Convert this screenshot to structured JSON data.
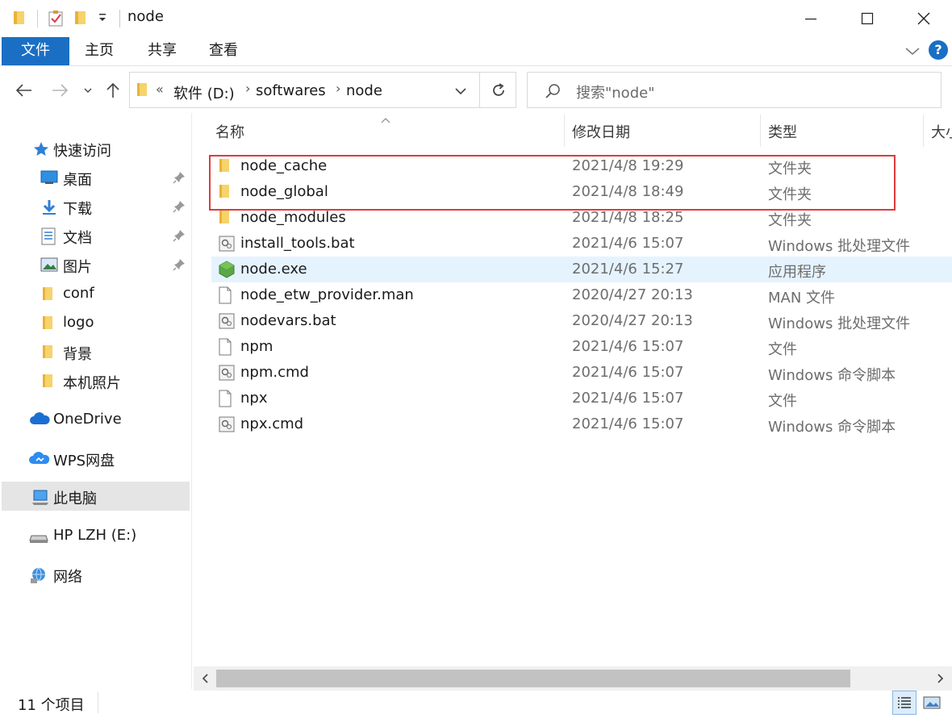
{
  "window": {
    "title": "node",
    "minimize_icon": "minimize-icon",
    "maximize_icon": "maximize-icon",
    "close_icon": "close-icon"
  },
  "ribbon": {
    "tabs": [
      {
        "label": "文件"
      },
      {
        "label": "主页"
      },
      {
        "label": "共享"
      },
      {
        "label": "查看"
      }
    ],
    "accent": "#1a6fc4",
    "help_label": "?"
  },
  "address": {
    "overflow": "«",
    "crumbs": [
      "软件 (D:)",
      "softwares",
      "node"
    ],
    "separator": "›"
  },
  "search": {
    "placeholder": "搜索\"node\""
  },
  "sidebar": {
    "quick_access": "快速访问",
    "pinned": [
      {
        "label": "桌面",
        "icon": "desktop-icon"
      },
      {
        "label": "下载",
        "icon": "download-icon"
      },
      {
        "label": "文档",
        "icon": "document-icon"
      },
      {
        "label": "图片",
        "icon": "pictures-icon"
      }
    ],
    "folders": [
      {
        "label": "conf"
      },
      {
        "label": "logo"
      },
      {
        "label": "背景"
      },
      {
        "label": "本机照片"
      }
    ],
    "onedrive": "OneDrive",
    "wps": "WPS网盘",
    "this_pc": "此电脑",
    "drive": "HP LZH (E:)",
    "network": "网络"
  },
  "columns": {
    "name": "名称",
    "date": "修改日期",
    "type": "类型",
    "size": "大小"
  },
  "files": [
    {
      "name": "node_cache",
      "date": "2021/4/8 19:29",
      "type": "文件夹",
      "icon": "folder-icon"
    },
    {
      "name": "node_global",
      "date": "2021/4/8 18:49",
      "type": "文件夹",
      "icon": "folder-icon"
    },
    {
      "name": "node_modules",
      "date": "2021/4/8 18:25",
      "type": "文件夹",
      "icon": "folder-icon"
    },
    {
      "name": "install_tools.bat",
      "date": "2021/4/6 15:07",
      "type": "Windows 批处理文件",
      "icon": "batch-file-icon"
    },
    {
      "name": "node.exe",
      "date": "2021/4/6 15:27",
      "type": "应用程序",
      "icon": "nodejs-exe-icon",
      "highlighted": true
    },
    {
      "name": "node_etw_provider.man",
      "date": "2020/4/27 20:13",
      "type": "MAN 文件",
      "icon": "file-icon"
    },
    {
      "name": "nodevars.bat",
      "date": "2020/4/27 20:13",
      "type": "Windows 批处理文件",
      "icon": "batch-file-icon"
    },
    {
      "name": "npm",
      "date": "2021/4/6 15:07",
      "type": "文件",
      "icon": "file-icon"
    },
    {
      "name": "npm.cmd",
      "date": "2021/4/6 15:07",
      "type": "Windows 命令脚本",
      "icon": "batch-file-icon"
    },
    {
      "name": "npx",
      "date": "2021/4/6 15:07",
      "type": "文件",
      "icon": "file-icon"
    },
    {
      "name": "npx.cmd",
      "date": "2021/4/6 15:07",
      "type": "Windows 命令脚本",
      "icon": "batch-file-icon"
    }
  ],
  "status": {
    "item_count": "11 个项目"
  },
  "colors": {
    "selection_bg": "#e5f3ff",
    "annotation_border": "#e0393e",
    "folder": "#f2c24f"
  }
}
